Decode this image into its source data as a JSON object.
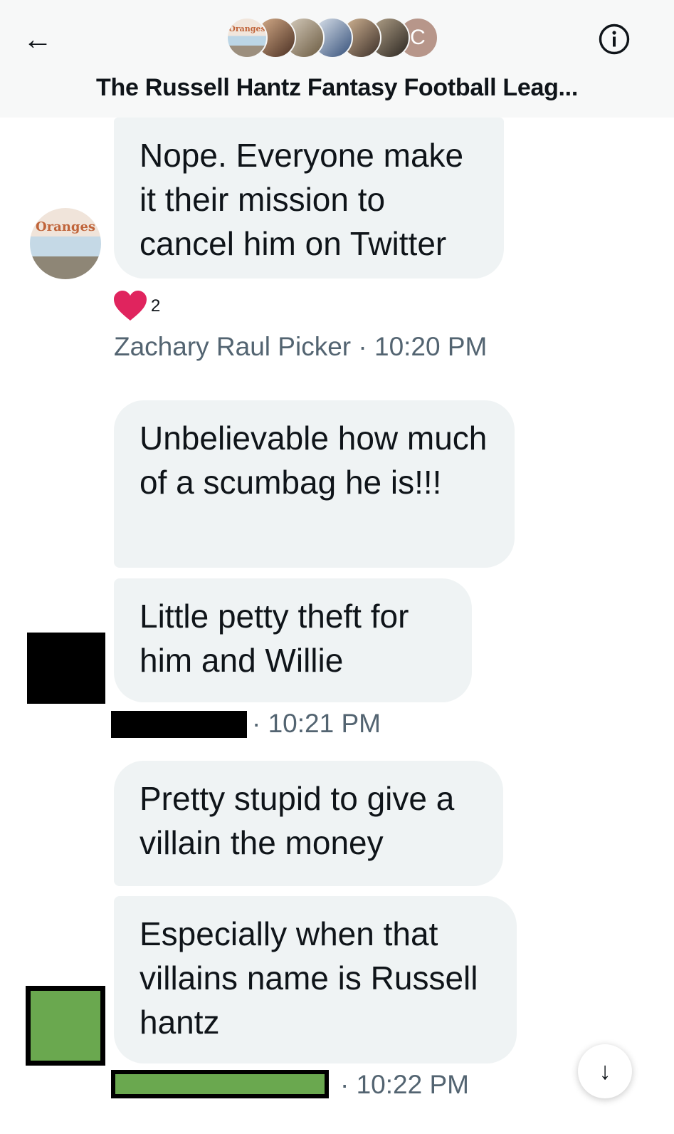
{
  "header": {
    "back_icon": "arrow-left-icon",
    "title": "The Russell Hantz Fantasy Football Leag...",
    "avatar_initial": "C",
    "avatar_sign_text": "Oranges",
    "info_icon": "info-icon"
  },
  "messages": [
    {
      "text": "Nope. Everyone make it their mission to cancel him on Twitter"
    },
    {
      "text": "Unbelievable how much of a scumbag he is!!!"
    },
    {
      "text": "Little petty theft for him and Willie"
    },
    {
      "text": "Pretty stupid to give a villain the money"
    },
    {
      "text": "Especially when that villains name is Russell hantz"
    }
  ],
  "reaction": {
    "icon": "heart-icon",
    "count": "2"
  },
  "meta": [
    {
      "sender": "Zachary Raul Picker",
      "time": "· 10:20 PM"
    },
    {
      "time": "· 10:21 PM"
    },
    {
      "time": "· 10:22 PM"
    }
  ],
  "colors": {
    "bubble": "#eff3f4",
    "header_bg": "#f7f8f8",
    "heart": "#e0245e",
    "redaction_green": "#6aa84f",
    "meta_text": "#536471"
  },
  "scroll_button_icon": "arrow-down-icon"
}
